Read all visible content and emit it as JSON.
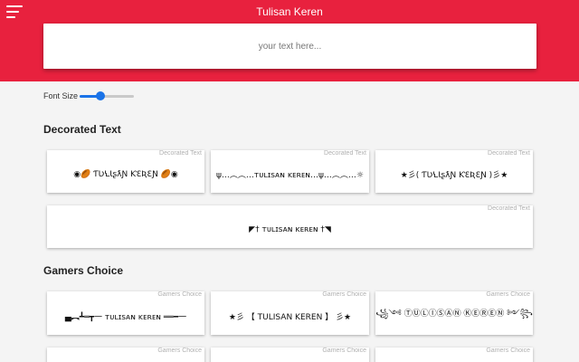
{
  "header": {
    "title": "Tulisan Keren",
    "input_placeholder": "your text here...",
    "background_color": "#e8213e"
  },
  "controls": {
    "font_size_label": "Font Size",
    "font_size_level": 0.38
  },
  "sections": [
    {
      "title": "Decorated Text",
      "cards": [
        {
          "tag": "Decorated Text",
          "text": "◉🏉 ƬƲꝆƖʂƛƝ ƘƐƦƐƝ 🏉◉"
        },
        {
          "tag": "Decorated Text",
          "text": "ψ…︵︵…ᴛᴜʟɪsᴀɴ ᴋᴇʀᴇɴ…ψ…︵︵…☼"
        },
        {
          "tag": "Decorated Text",
          "text": "★彡( ƬƲꝆƖʂƛƝ ƘƐƦƐƝ )彡★"
        },
        {
          "tag": "Decorated Text",
          "text": "◤† ᴛᴜʟɪsᴀɴ ᴋᴇʀᴇɴ †◥"
        }
      ]
    },
    {
      "title": "Gamers Choice",
      "cards": [
        {
          "tag": "Gamers Choice",
          "text": "▄︻┻═┳一 ᴛᴜʟɪsᴀɴ ᴋᴇʀᴇɴ ══━一"
        },
        {
          "tag": "Gamers Choice",
          "text": "★彡 【 TULISAN KEREN 】 彡★"
        },
        {
          "tag": "Gamers Choice",
          "text": "꧁༺ ⓉⓊⓁⒾⓈⒶⓃ ⓀⒺⓇⒺⓃ ༻꧂"
        },
        {
          "tag": "Gamers Choice",
          "text": ""
        },
        {
          "tag": "Gamers Choice",
          "text": ""
        },
        {
          "tag": "Gamers Choice",
          "text": ""
        }
      ]
    }
  ]
}
